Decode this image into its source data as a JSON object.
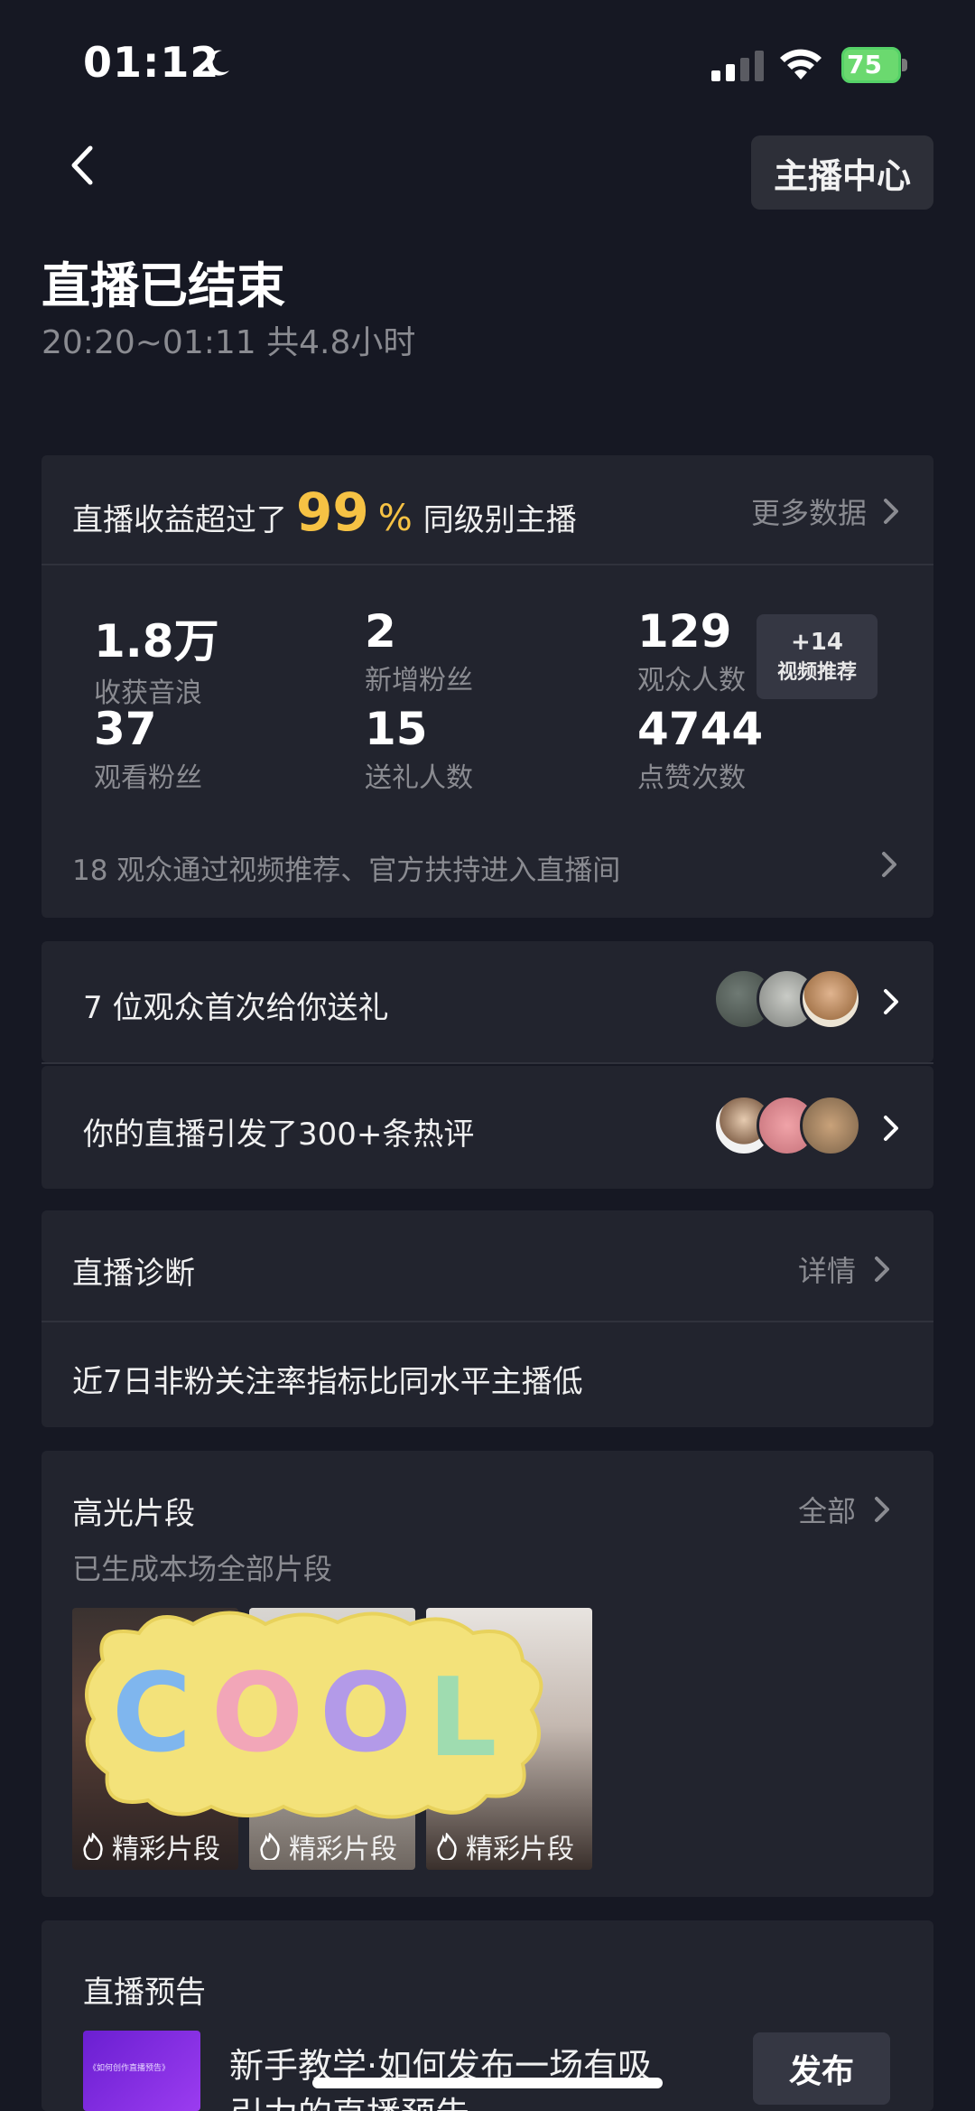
{
  "status_bar": {
    "time": "01:12",
    "battery": "75"
  },
  "header": {
    "anchor_center_label": "主播中心"
  },
  "summary": {
    "title": "直播已结束",
    "subtitle": "20:20~01:11 共4.8小时"
  },
  "revenue": {
    "prefix": "直播收益超过了",
    "percent": "99",
    "percent_sign": "%",
    "suffix": "同级别主播",
    "more_label": "更多数据"
  },
  "stats": [
    {
      "value": "1.8万",
      "label": "收获音浪"
    },
    {
      "value": "2",
      "label": "新增粉丝"
    },
    {
      "value": "129",
      "label": "观众人数"
    },
    {
      "value": "37",
      "label": "观看粉丝"
    },
    {
      "value": "15",
      "label": "送礼人数"
    },
    {
      "value": "4744",
      "label": "点赞次数"
    }
  ],
  "recommend_badge": {
    "count": "+14",
    "label": "视频推荐"
  },
  "traffic_note": "18 观众通过视频推荐、官方扶持进入直播间",
  "gift_row": {
    "text": "7 位观众首次给你送礼"
  },
  "comment_row": {
    "text": "你的直播引发了300+条热评"
  },
  "diagnosis": {
    "title": "直播诊断",
    "link": "详情",
    "note": "近7日非粉关注率指标比同水平主播低"
  },
  "highlights": {
    "title": "高光片段",
    "link": "全部",
    "subtitle": "已生成本场全部片段",
    "sticker_text": "COOL",
    "clips": [
      {
        "label": "精彩片段"
      },
      {
        "label": "精彩片段"
      },
      {
        "label": "精彩片段"
      }
    ]
  },
  "preview": {
    "title": "直播预告",
    "thumb_caption": "《如何创作直播预告》",
    "tutorial_line1": "新手教学·如何发布一场有吸",
    "tutorial_line2": "引力的直播预告",
    "publish_label": "发布"
  },
  "colors": {
    "background": "#161823",
    "card": "#22242e",
    "accent_gold": "#f6c244",
    "muted": "#8a8b91"
  }
}
